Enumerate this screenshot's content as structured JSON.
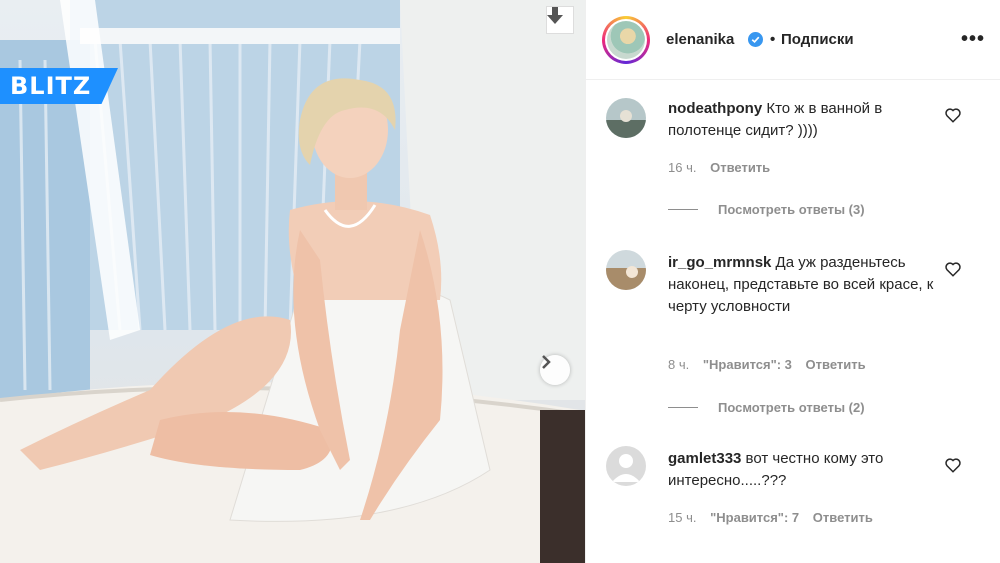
{
  "watermark": {
    "logo_text": "BLITZ",
    "brand_color": "#1e90ff"
  },
  "header": {
    "username": "elenanika",
    "verified": true,
    "dot": "•",
    "follow_label": "Подписки",
    "more_icon": "more-horizontal-icon"
  },
  "comments": [
    {
      "username": "nodeathpony",
      "text": "Кто ж в ванной в полотенце сидит? ))))",
      "time": "16 ч.",
      "likes": "",
      "reply_label": "Ответить",
      "view_replies": "Посмотреть ответы (3)"
    },
    {
      "username": "ir_go_mrmnsk",
      "text": "Да уж разденьтесь наконец, представьте во всей красе, к черту условности",
      "time": "8 ч.",
      "likes": "\"Нравится\": 3",
      "reply_label": "Ответить",
      "view_replies": "Посмотреть ответы (2)"
    },
    {
      "username": "gamlet333",
      "text": "вот честно кому это интересно.....???",
      "time": "15 ч.",
      "likes": "\"Нравится\": 7",
      "reply_label": "Ответить",
      "view_replies": ""
    }
  ],
  "icons": {
    "download": "download-arrow-icon",
    "next": "chevron-right-icon",
    "like": "heart-icon"
  }
}
